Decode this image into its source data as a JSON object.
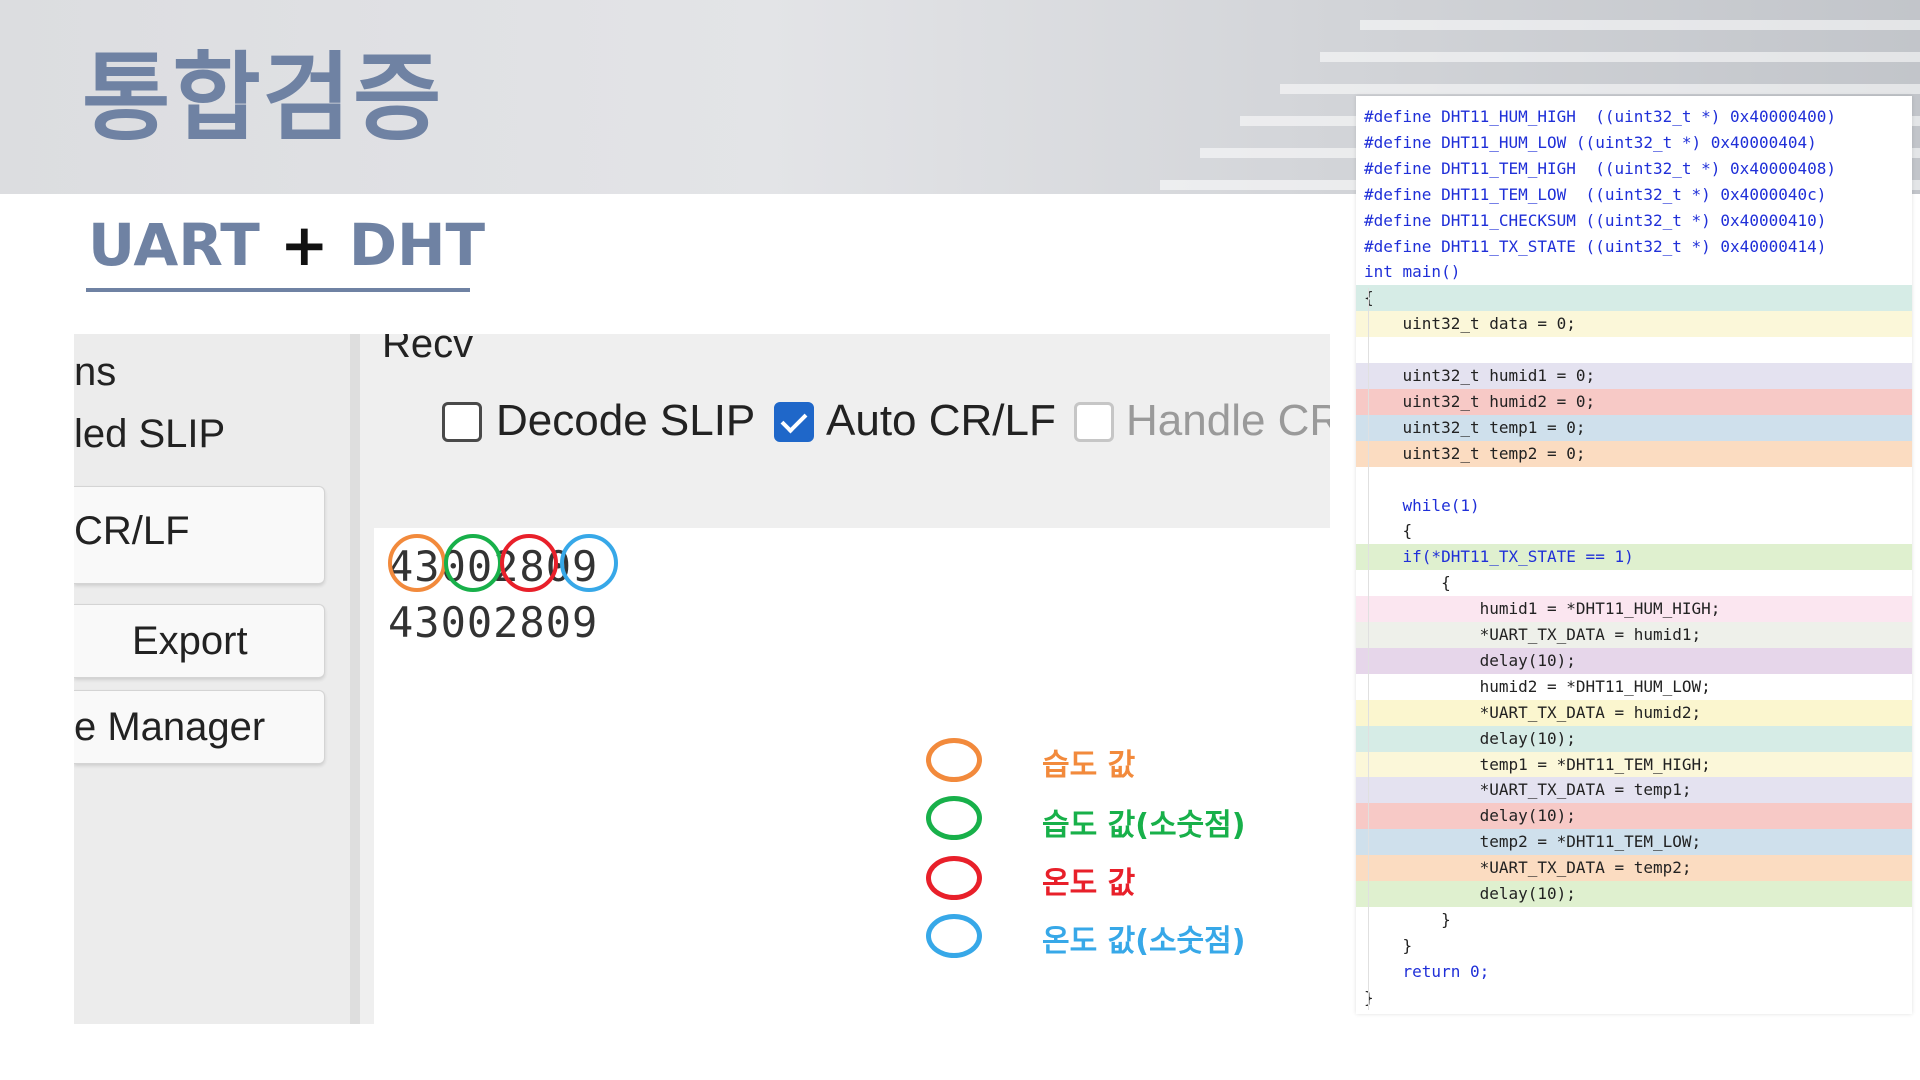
{
  "slide": {
    "title": "통합검증",
    "section_left": "UART",
    "section_plus": "+",
    "section_right": "DHT"
  },
  "terminal": {
    "left_panel": {
      "item1": "ns",
      "item2": "led SLIP",
      "item3": "CR/LF",
      "export_button": "Export",
      "manager_button": "e Manager"
    },
    "recv_label": "Recv",
    "options": [
      {
        "label": "Decode SLIP",
        "checked": false,
        "enabled": true
      },
      {
        "label": "Auto CR/LF",
        "checked": true,
        "enabled": true
      },
      {
        "label": "Handle CR/LF",
        "checked": false,
        "enabled": false
      }
    ],
    "output_lines": [
      "43002809",
      "43002809"
    ]
  },
  "legend": [
    {
      "label": "습도 값",
      "color": "#f28a3c"
    },
    {
      "label": "습도 값(소숫점)",
      "color": "#18b04a"
    },
    {
      "label": "온도 값",
      "color": "#e8202a"
    },
    {
      "label": "온도 값(소숫점)",
      "color": "#37a8e8"
    }
  ],
  "code": {
    "lines": [
      {
        "text": "#define DHT11_HUM_HIGH  ((uint32_t *) 0x40000400)",
        "bg": "#ffffff",
        "kind": "define"
      },
      {
        "text": "#define DHT11_HUM_LOW ((uint32_t *) 0x40000404)",
        "bg": "#ffffff",
        "kind": "define"
      },
      {
        "text": "#define DHT11_TEM_HIGH  ((uint32_t *) 0x40000408)",
        "bg": "#ffffff",
        "kind": "define"
      },
      {
        "text": "#define DHT11_TEM_LOW  ((uint32_t *) 0x4000040c)",
        "bg": "#ffffff",
        "kind": "define"
      },
      {
        "text": "#define DHT11_CHECKSUM ((uint32_t *) 0x40000410)",
        "bg": "#ffffff",
        "kind": "define"
      },
      {
        "text": "#define DHT11_TX_STATE ((uint32_t *) 0x40000414)",
        "bg": "#ffffff",
        "kind": "define"
      },
      {
        "text": "int main()",
        "bg": "#ffffff",
        "kind": "int"
      },
      {
        "text": "{",
        "bg": "#d6ece6",
        "kind": "plain"
      },
      {
        "text": "    uint32_t data = 0;",
        "bg": "#fbf7d9",
        "kind": "plain"
      },
      {
        "text": "",
        "bg": "#ffffff",
        "kind": "plain"
      },
      {
        "text": "    uint32_t humid1 = 0;",
        "bg": "#e4e2f0",
        "kind": "plain"
      },
      {
        "text": "    uint32_t humid2 = 0;",
        "bg": "#f7c9c6",
        "kind": "plain"
      },
      {
        "text": "    uint32_t temp1 = 0;",
        "bg": "#cfe0ec",
        "kind": "plain"
      },
      {
        "text": "    uint32_t temp2 = 0;",
        "bg": "#fbdcc1",
        "kind": "plain"
      },
      {
        "text": "",
        "bg": "#ffffff",
        "kind": "plain"
      },
      {
        "text": "    while(1)",
        "bg": "#ffffff",
        "kind": "while"
      },
      {
        "text": "    {",
        "bg": "#ffffff",
        "kind": "plain"
      },
      {
        "text": "    if(*DHT11_TX_STATE == 1)",
        "bg": "#dff0cf",
        "kind": "if"
      },
      {
        "text": "        {",
        "bg": "#ffffff",
        "kind": "plain"
      },
      {
        "text": "            humid1 = *DHT11_HUM_HIGH;",
        "bg": "#fbe6f0",
        "kind": "plain"
      },
      {
        "text": "            *UART_TX_DATA = humid1;",
        "bg": "#eef0ea",
        "kind": "plain"
      },
      {
        "text": "            delay(10);",
        "bg": "#e6d6ea",
        "kind": "delay"
      },
      {
        "text": "            humid2 = *DHT11_HUM_LOW;",
        "bg": "#ffffff",
        "kind": "plain"
      },
      {
        "text": "            *UART_TX_DATA = humid2;",
        "bg": "#fbf6cf",
        "kind": "plain"
      },
      {
        "text": "            delay(10);",
        "bg": "#d6ece6",
        "kind": "delay"
      },
      {
        "text": "            temp1 = *DHT11_TEM_HIGH;",
        "bg": "#fbf7d9",
        "kind": "plain"
      },
      {
        "text": "            *UART_TX_DATA = temp1;",
        "bg": "#e4e2f0",
        "kind": "plain"
      },
      {
        "text": "            delay(10);",
        "bg": "#f7c9c6",
        "kind": "delay"
      },
      {
        "text": "            temp2 = *DHT11_TEM_LOW;",
        "bg": "#cfe0ec",
        "kind": "plain"
      },
      {
        "text": "            *UART_TX_DATA = temp2;",
        "bg": "#fbdcc1",
        "kind": "plain"
      },
      {
        "text": "            delay(10);",
        "bg": "#dff0cf",
        "kind": "delay"
      },
      {
        "text": "        }",
        "bg": "#ffffff",
        "kind": "plain"
      },
      {
        "text": "    }",
        "bg": "#ffffff",
        "kind": "plain"
      },
      {
        "text": "    return 0;",
        "bg": "#ffffff",
        "kind": "return"
      },
      {
        "text": "}",
        "bg": "#ffffff",
        "kind": "plain"
      }
    ]
  }
}
